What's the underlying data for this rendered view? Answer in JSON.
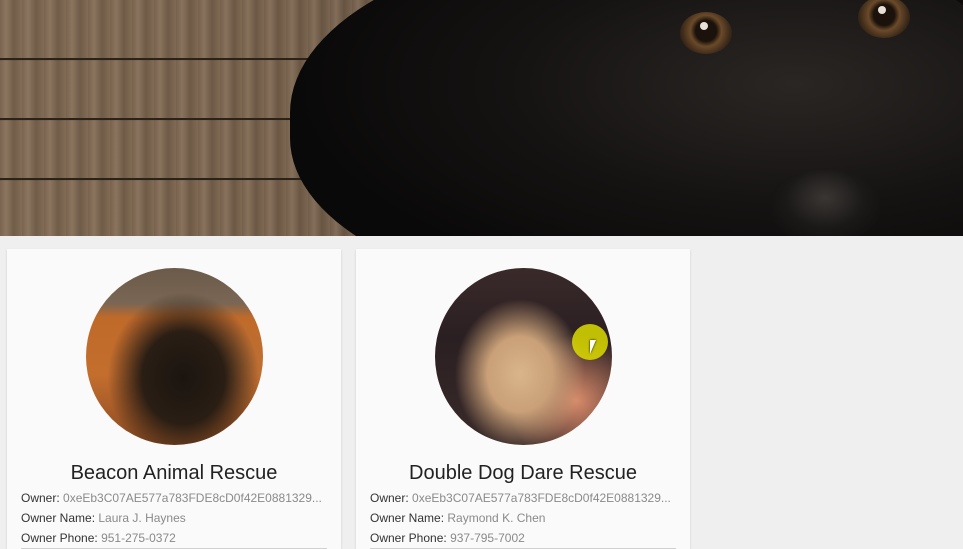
{
  "rescues": [
    {
      "name": "Beacon Animal Rescue",
      "owner_label": "Owner:",
      "owner": "0xeEb3C07AE577a783FDE8cD0f42E0881329...",
      "owner_name_label": "Owner Name:",
      "owner_name": "Laura J. Haynes",
      "owner_phone_label": "Owner Phone:",
      "owner_phone": "951-275-0372"
    },
    {
      "name": "Double Dog Dare Rescue",
      "owner_label": "Owner:",
      "owner": "0xeEb3C07AE577a783FDE8cD0f42E0881329...",
      "owner_name_label": "Owner Name:",
      "owner_name": "Raymond K. Chen",
      "owner_phone_label": "Owner Phone:",
      "owner_phone": "937-795-7002"
    }
  ]
}
